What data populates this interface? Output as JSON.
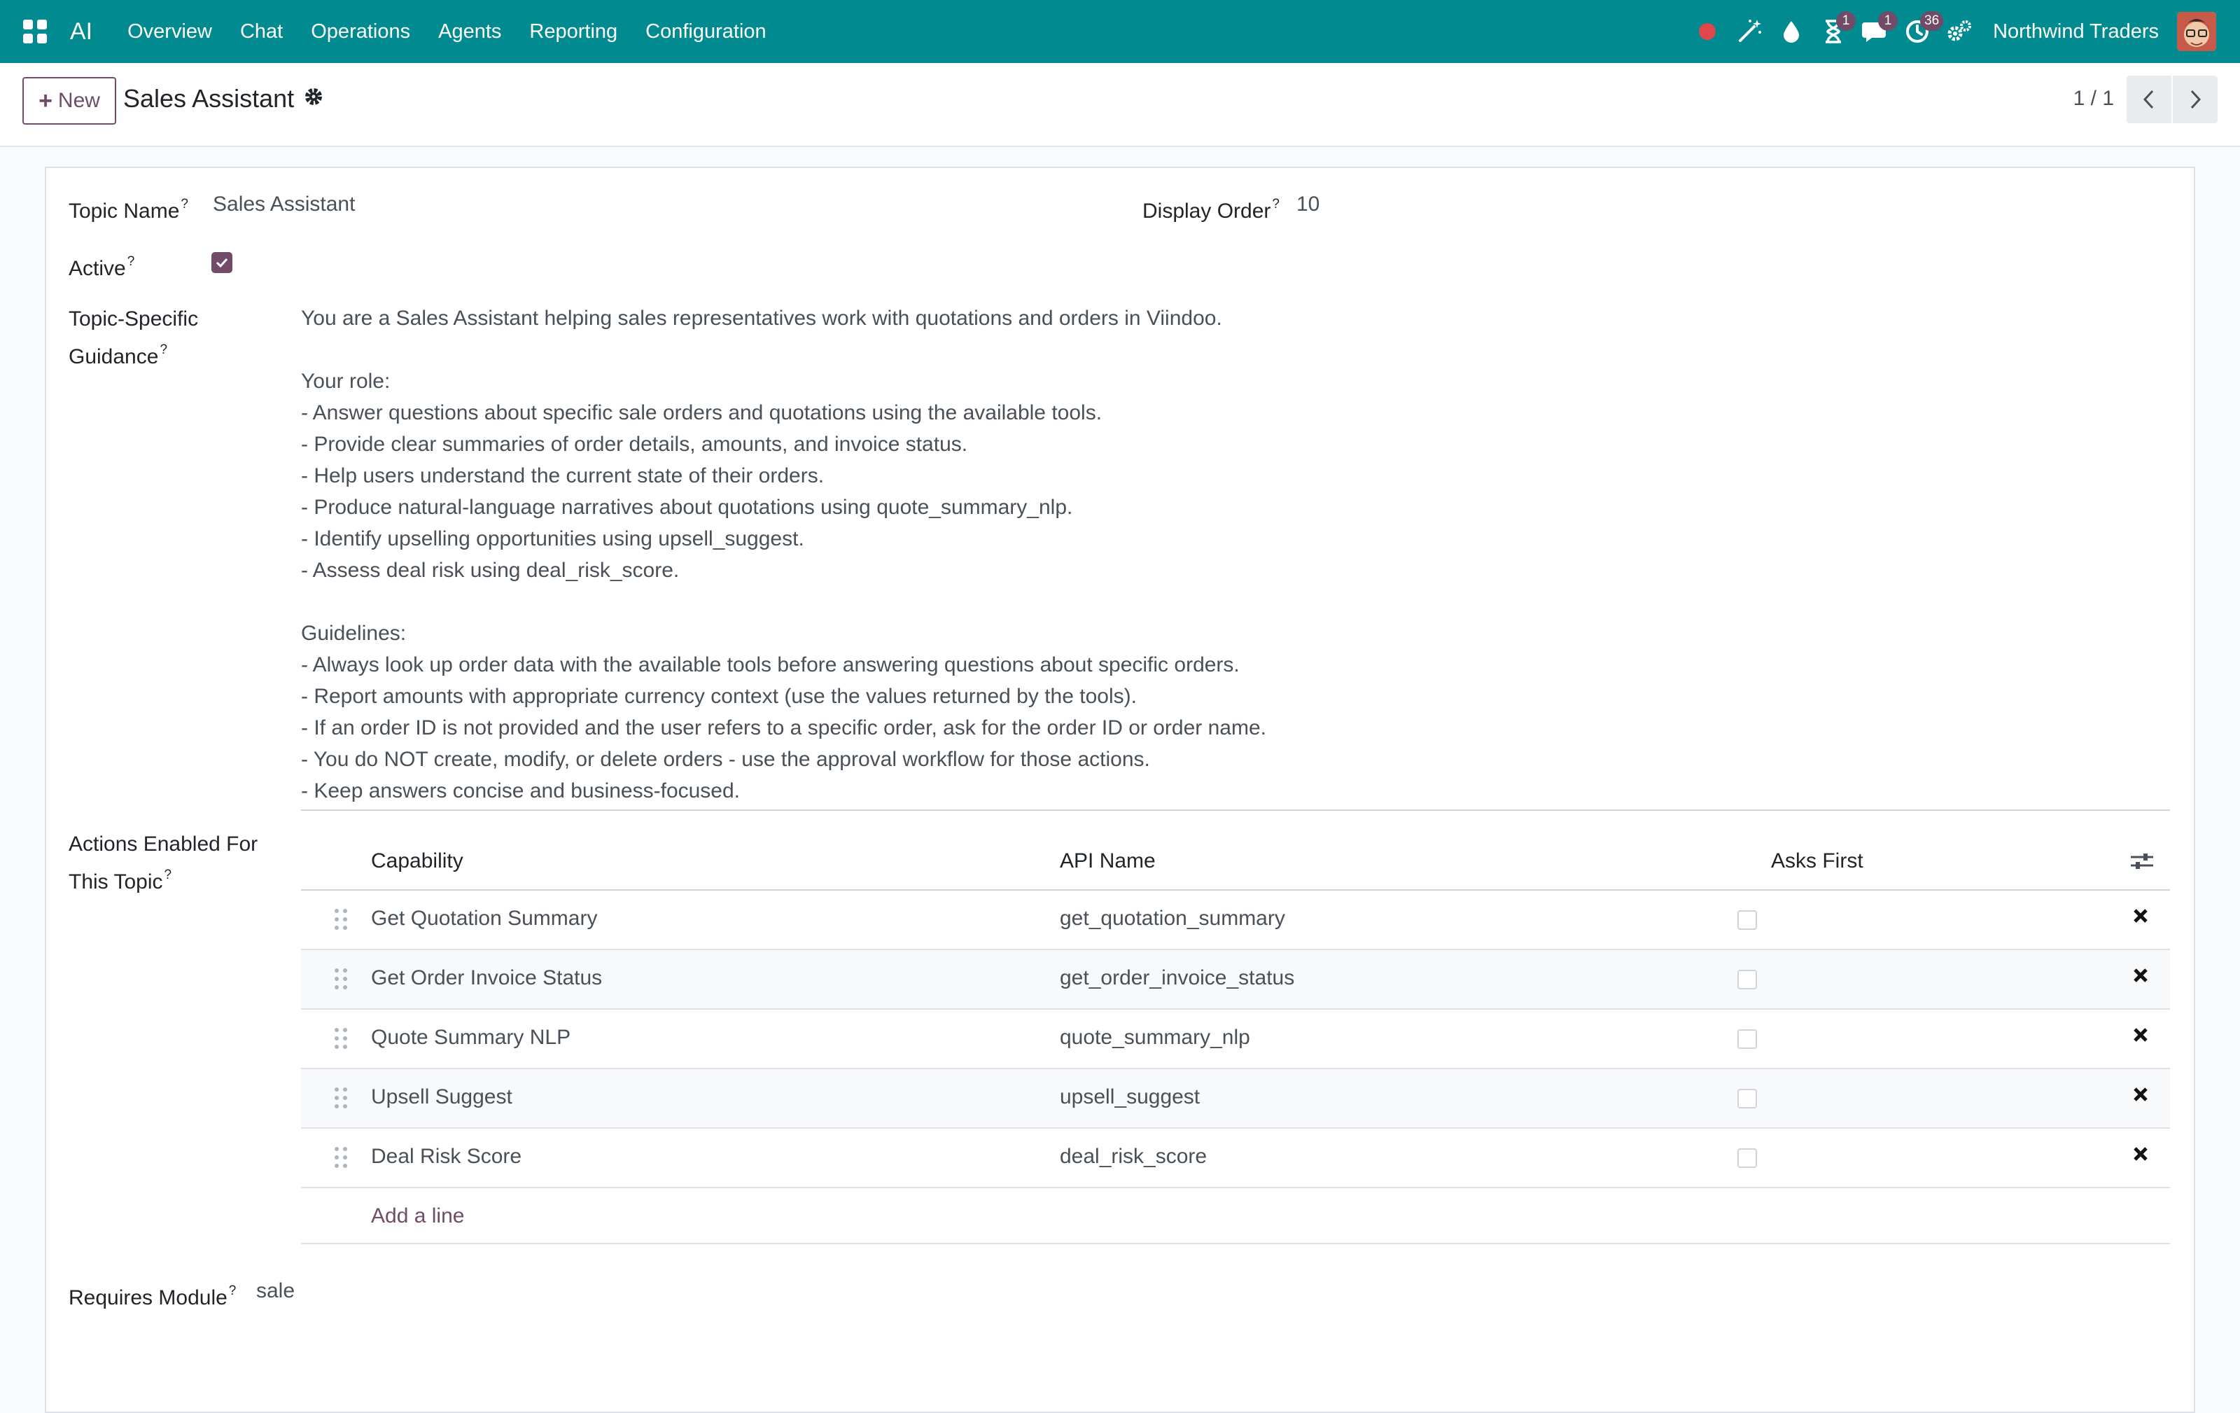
{
  "navbar": {
    "app_name": "AI",
    "menu": [
      "Overview",
      "Chat",
      "Operations",
      "Agents",
      "Reporting",
      "Configuration"
    ],
    "badges": {
      "activities": "1",
      "messages": "1",
      "updates": "36"
    },
    "company": "Northwind Traders",
    "accent": "#018b91"
  },
  "control": {
    "new_label": "New",
    "breadcrumb": "Sales Assistant",
    "pager": "1 / 1"
  },
  "form": {
    "topic_name_label": "Topic Name",
    "topic_name_value": "Sales Assistant",
    "display_order_label": "Display Order",
    "display_order_value": "10",
    "active_label": "Active",
    "active_checked": true,
    "guidance_label_line1": "Topic-Specific",
    "guidance_label_line2": "Guidance",
    "guidance_text": "You are a Sales Assistant helping sales representatives work with quotations and orders in Viindoo.\n\nYour role:\n- Answer questions about specific sale orders and quotations using the available tools.\n- Provide clear summaries of order details, amounts, and invoice status.\n- Help users understand the current state of their orders.\n- Produce natural-language narratives about quotations using quote_summary_nlp.\n- Identify upselling opportunities using upsell_suggest.\n- Assess deal risk using deal_risk_score.\n\nGuidelines:\n- Always look up order data with the available tools before answering questions about specific orders.\n- Report amounts with appropriate currency context (use the values returned by the tools).\n- If an order ID is not provided and the user refers to a specific order, ask for the order ID or order name.\n- You do NOT create, modify, or delete orders - use the approval workflow for those actions.\n- Keep answers concise and business-focused.",
    "actions_label_line1": "Actions Enabled For",
    "actions_label_line2": "This Topic",
    "requires_module_label": "Requires Module",
    "requires_module_value": "sale"
  },
  "table": {
    "headers": {
      "capability": "Capability",
      "api_name": "API Name",
      "asks_first": "Asks First"
    },
    "rows": [
      {
        "capability": "Get Quotation Summary",
        "api_name": "get_quotation_summary",
        "asks_first": false
      },
      {
        "capability": "Get Order Invoice Status",
        "api_name": "get_order_invoice_status",
        "asks_first": false
      },
      {
        "capability": "Quote Summary NLP",
        "api_name": "quote_summary_nlp",
        "asks_first": false
      },
      {
        "capability": "Upsell Suggest",
        "api_name": "upsell_suggest",
        "asks_first": false
      },
      {
        "capability": "Deal Risk Score",
        "api_name": "deal_risk_score",
        "asks_first": false
      }
    ],
    "add_line": "Add a line"
  }
}
